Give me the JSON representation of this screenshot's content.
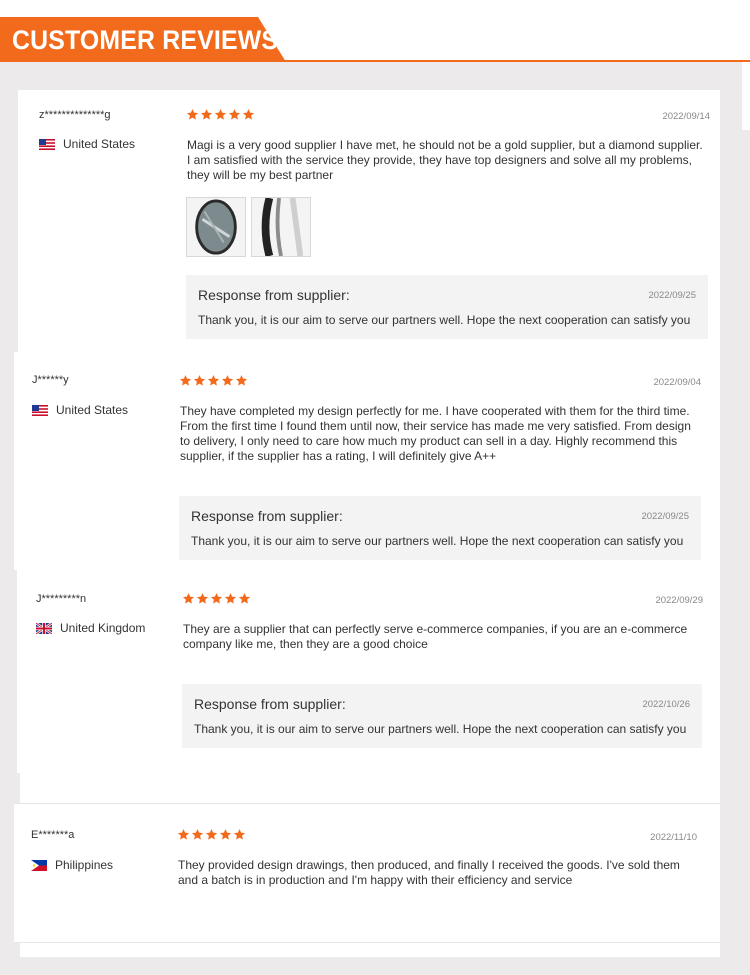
{
  "header": {
    "title": "CUSTOMER REVIEWS"
  },
  "colors": {
    "accent": "#f26b1d",
    "star": "#f26b1d",
    "response_bg": "#f3f3f3"
  },
  "reviews": [
    {
      "name": "z**************g",
      "country": "United States",
      "flag": "us-flag",
      "rating": 5,
      "date": "2022/09/14",
      "text": "Magi is a very good supplier I have met, he should not be a gold supplier, but a diamond supplier. I am satisfied with the service they provide, they have top designers and solve all my problems, they will be my best partner",
      "images": [
        "round-mirror-photo",
        "mirror-frame-photo"
      ],
      "response": {
        "title": "Response from supplier:",
        "date": "2022/09/25",
        "text": "Thank you, it is our aim to serve our partners well. Hope the next cooperation can satisfy you"
      }
    },
    {
      "name": "J******y",
      "country": "United States",
      "flag": "us-flag",
      "rating": 5,
      "date": "2022/09/04",
      "text": "They have completed my design perfectly for me. I have cooperated with them for the third time. From the first time I found them until now, their service has made me very satisfied. From design to delivery, I only need to care how much my product can sell in a day. Highly recommend this supplier, if the supplier has a rating, I will definitely give A++",
      "response": {
        "title": "Response from supplier:",
        "date": "2022/09/25",
        "text": "Thank you, it is our aim to serve our partners well. Hope the next cooperation can satisfy you"
      }
    },
    {
      "name": "J*********n",
      "country": "United Kingdom",
      "flag": "uk-flag",
      "rating": 5,
      "date": "2022/09/29",
      "text": "They are a supplier that can perfectly serve e-commerce companies, if you are an e-commerce company like me, then they are a good choice",
      "response": {
        "title": "Response from supplier:",
        "date": "2022/10/26",
        "text": "Thank you, it is our aim to serve our partners well. Hope the next cooperation can satisfy you"
      }
    },
    {
      "name": "E*******a",
      "country": "Philippines",
      "flag": "ph-flag",
      "rating": 5,
      "date": "2022/11/10",
      "text": "They provided design drawings, then produced, and finally I received the goods. I've sold them and a batch is in production and I'm happy with their efficiency and service"
    }
  ]
}
